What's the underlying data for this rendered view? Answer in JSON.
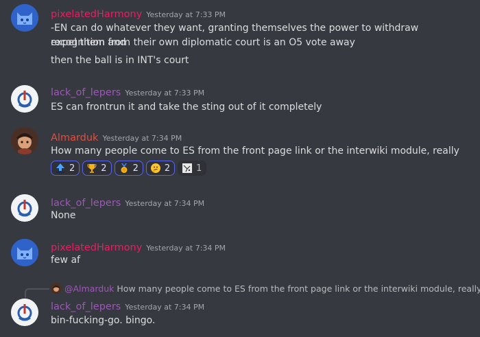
{
  "messages": [
    {
      "username": "pixelatedHarmony",
      "timestamp": "Yesterday at 7:33 PM",
      "lines": [
        "-EN can do whatever they want, granting themselves the power to withdraw recognition and",
        "expel them from their own diplomatic court is an O5 vote away",
        "then the ball is in INT's court"
      ]
    },
    {
      "username": "lack_of_lepers",
      "timestamp": "Yesterday at 7:33 PM",
      "lines": [
        "ES can frontrun it and take the sting out of it completely"
      ]
    },
    {
      "username": "Almarduk",
      "timestamp": "Yesterday at 7:34 PM",
      "lines": [
        "How many people come to ES from the front page link or the interwiki module, really"
      ],
      "reactions": [
        {
          "icon": "this-arrow-emoji",
          "count": "2"
        },
        {
          "icon": "trophy-emoji",
          "count": "2"
        },
        {
          "icon": "medal-emoji",
          "count": "2"
        },
        {
          "icon": "thinking-emoji",
          "count": "2"
        },
        {
          "icon": "sign-emoji",
          "count": "1"
        }
      ]
    },
    {
      "username": "lack_of_lepers",
      "timestamp": "Yesterday at 7:34 PM",
      "lines": [
        "None"
      ]
    },
    {
      "username": "pixelatedHarmony",
      "timestamp": "Yesterday at 7:34 PM",
      "lines": [
        "few af"
      ]
    },
    {
      "reply": {
        "mention": "@Almarduk",
        "text": "How many people come to ES from the front page link or the interwiki module, really"
      },
      "username": "lack_of_lepers",
      "timestamp": "Yesterday at 7:34 PM",
      "lines": [
        "bin-fucking-go. bingo."
      ]
    }
  ],
  "colors": {
    "background": "#36393f",
    "pixelatedHarmony": "#e91e63",
    "lack_of_lepers": "#9b59b6",
    "Almarduk": "#e74c3c"
  }
}
